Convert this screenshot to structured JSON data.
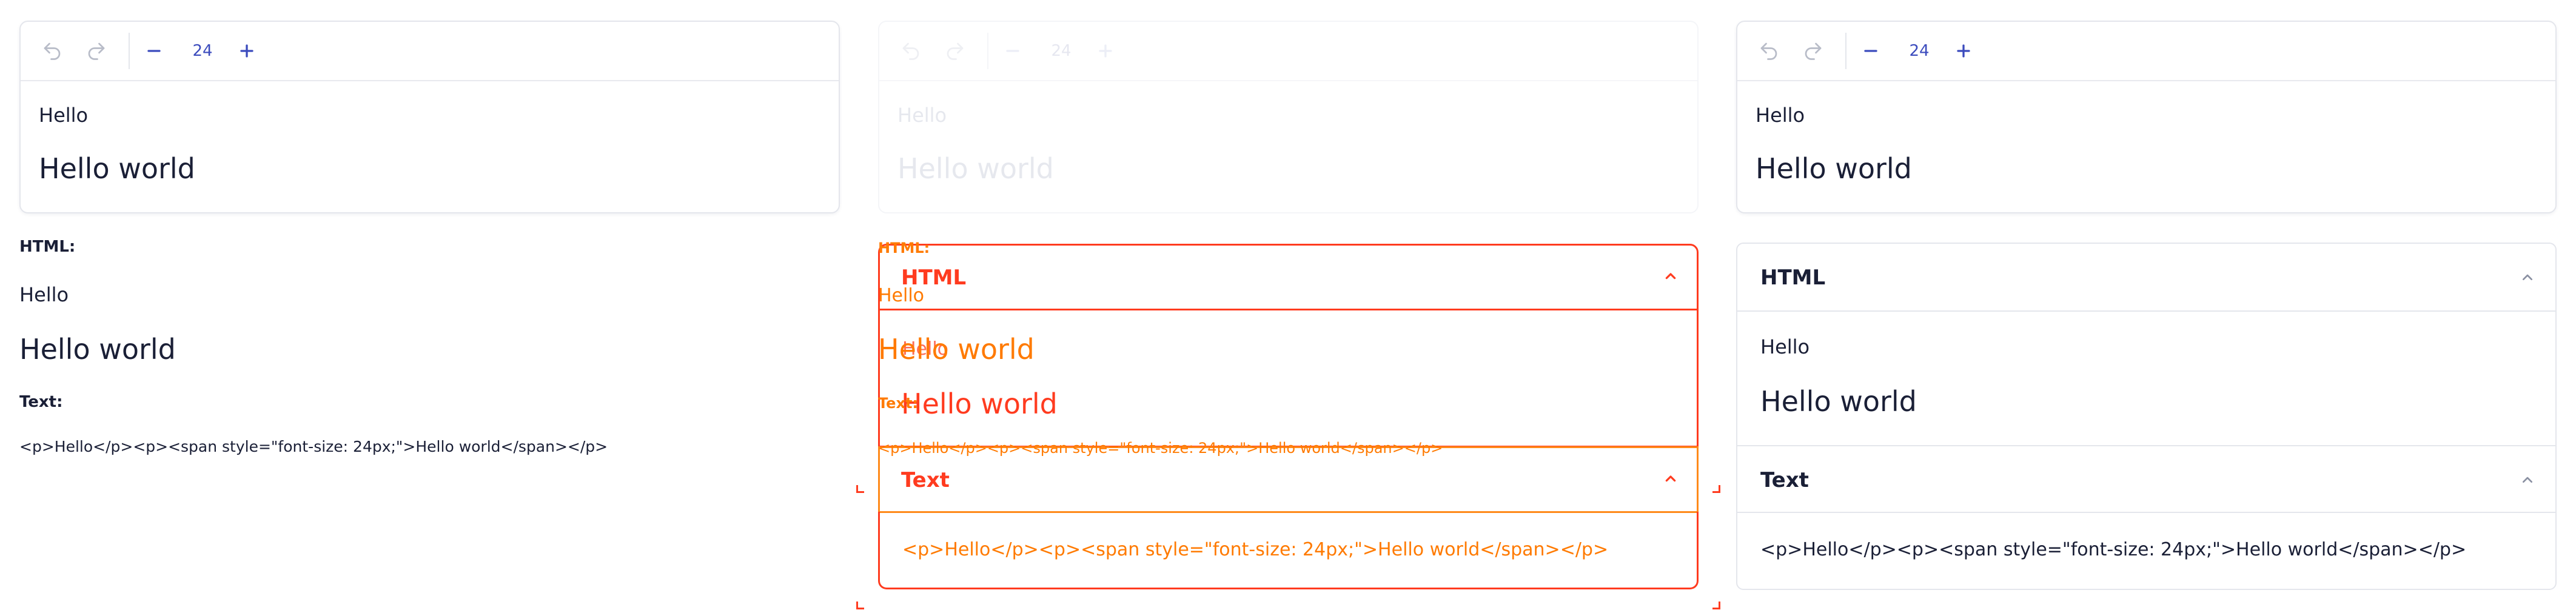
{
  "toolbar": {
    "font_size": "24",
    "undo_icon": "undo-icon",
    "redo_icon": "redo-icon",
    "minus_icon": "minus-icon",
    "plus_icon": "plus-icon"
  },
  "editor": {
    "line1": "Hello",
    "line2": "Hello world"
  },
  "output": {
    "html_label": "HTML:",
    "text_label": "Text:",
    "html_line1": "Hello",
    "html_line2": "Hello world",
    "code": "<p>Hello</p><p><span style=\"font-size: 24px;\">Hello world</span></p>"
  },
  "accordion": {
    "html_title": "HTML",
    "text_title": "Text",
    "chevron_icon": "chevron-up-icon"
  },
  "colors": {
    "accent": "#3b4bbd",
    "text": "#1a1f36",
    "border": "#e4e6ec",
    "overlay_red": "#ff3b1f",
    "overlay_orange": "#ff7a00"
  }
}
